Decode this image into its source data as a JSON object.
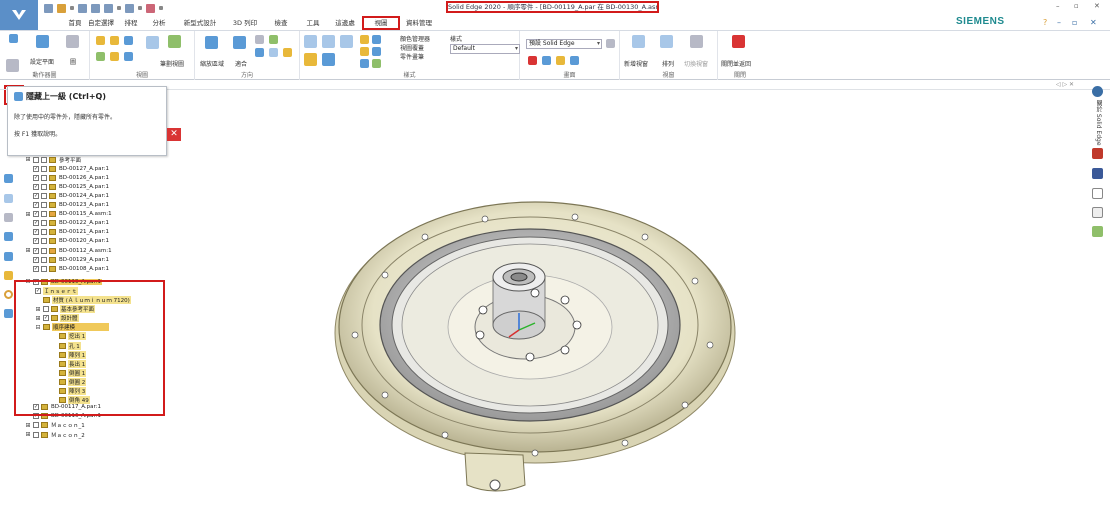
{
  "window": {
    "title": "Solid Edge 2020 - 順序零件 - [BD-00119_A.par 在 BD-00130_A.asm]",
    "brand": "SIEMENS",
    "controls": [
      "–",
      "▫",
      "✕"
    ],
    "help_controls": [
      "?",
      "–",
      "▫",
      "✕"
    ]
  },
  "tabs": [
    "首頁",
    "自定選擇",
    "排程",
    "分析",
    "新型式設計",
    "3D 列印",
    "檢查",
    "工具",
    "這邊處",
    "視圖",
    "資料管理"
  ],
  "active_tab": "視圖",
  "ribbon": {
    "groups": [
      {
        "label": "動作器圖"
      },
      {
        "label": "視圖"
      },
      {
        "label": "方向"
      },
      {
        "label": "樣式"
      },
      {
        "label": "畫面"
      },
      {
        "label": "視窗"
      },
      {
        "label": "關閉"
      }
    ],
    "buttons": {
      "set_plane": "設定平面",
      "pointer": "圖",
      "view_model": "筆劃視圖",
      "fit_view": "縮放區域",
      "fit": "適合",
      "color_manager": "顏色管理器",
      "view_overlay": "視圖覆蓋",
      "part_painter": "零件畫筆",
      "style": "樣式",
      "new_window": "新增視窗",
      "arrange": "排列",
      "switch_window": "切換視窗",
      "close_window": "關閉並返回"
    },
    "style_select": "Default",
    "screen_select": "預設 Solid Edge"
  },
  "tooltip": {
    "title": "隱藏上一級 (Ctrl+Q)",
    "line1": "除了使用中的零件外，隱藏所有零件。",
    "line2": "按 F1 獲取說明。"
  },
  "tree": {
    "top_rows": [
      {
        "label": "參考平面",
        "expand": "⊞",
        "checked": false,
        "asm": false
      },
      {
        "label": "BD-00127_A.par:1",
        "expand": "",
        "checked": true,
        "asm": false
      },
      {
        "label": "BD-00126_A.par:1",
        "expand": "",
        "checked": true,
        "asm": false
      },
      {
        "label": "BD-00125_A.par:1",
        "expand": "",
        "checked": true,
        "asm": false
      },
      {
        "label": "BD-00124_A.par:1",
        "expand": "",
        "checked": true,
        "asm": false
      },
      {
        "label": "BD-00123_A.par:1",
        "expand": "",
        "checked": true,
        "asm": false
      },
      {
        "label": "BD-00115_A.asm:1",
        "expand": "⊞",
        "checked": true,
        "asm": true
      },
      {
        "label": "BD-00122_A.par:1",
        "expand": "",
        "checked": true,
        "asm": false
      },
      {
        "label": "BD-00121_A.par:1",
        "expand": "",
        "checked": true,
        "asm": false
      },
      {
        "label": "BD-00120_A.par:1",
        "expand": "",
        "checked": true,
        "asm": false
      },
      {
        "label": "BD-00112_A.asm:1",
        "expand": "⊞",
        "checked": true,
        "asm": true
      },
      {
        "label": "BD-00129_A.par:1",
        "expand": "",
        "checked": true,
        "asm": false
      },
      {
        "label": "BD-00108_A.par:1",
        "expand": "",
        "checked": true,
        "asm": false
      }
    ],
    "active_part": "BD-00119_A.par:1",
    "sub_rows": [
      "Ｉｎｓｅｒｔ",
      "材質 (Ａｌｕｍｉｎｕｍ 7120)",
      "基本參考平面",
      "設計體",
      "順序建模"
    ],
    "features": [
      "挖出 1",
      "孔 1",
      "陣列 1",
      "長出 1",
      "倒圓 1",
      "倒圓 2",
      "陣列 3",
      "倒角 49"
    ],
    "bottom_rows": [
      {
        "label": "BD-00117_A.par:1",
        "expand": "",
        "checked": true
      },
      {
        "label": "BD-00116_A.par:1",
        "expand": "",
        "checked": true
      },
      {
        "label": "Ｍａｃｏｎ_1",
        "expand": "⊞",
        "checked": false
      },
      {
        "label": "Ｍａｃｏｎ_2",
        "expand": "⊞",
        "checked": false
      }
    ]
  },
  "side_panel": {
    "label": "關於 Solid Edge"
  },
  "strip": {
    "arrows": "◁ ▷ ✕"
  },
  "colors": {
    "accent": "#d21b1b",
    "brand": "#1e8a8f",
    "app_button": "#5b8fc8"
  }
}
